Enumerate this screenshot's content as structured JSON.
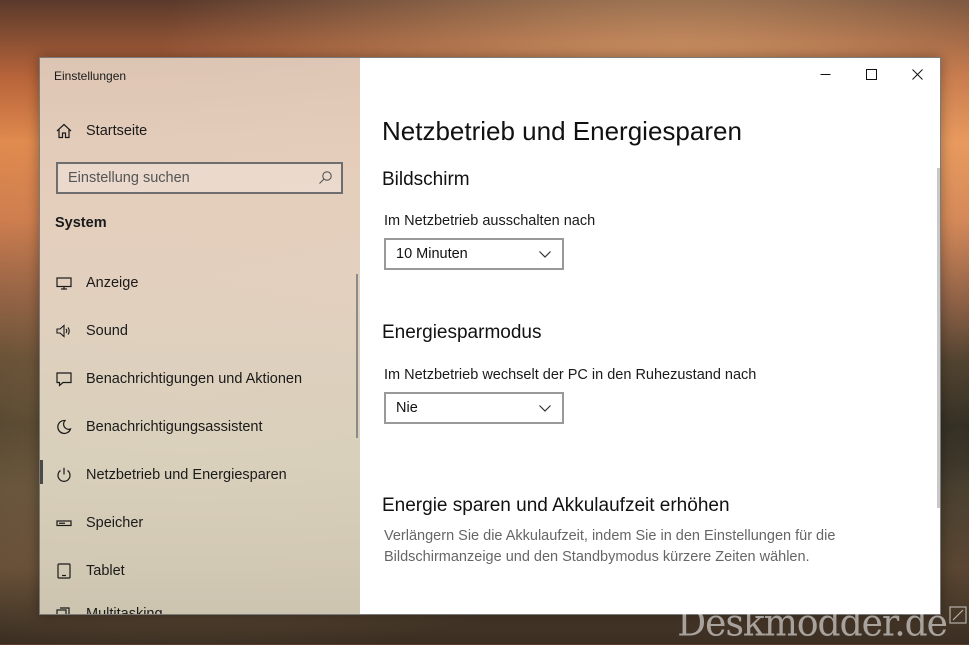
{
  "window": {
    "title": "Einstellungen"
  },
  "sidebar": {
    "home_label": "Startseite",
    "search_placeholder": "Einstellung suchen",
    "section": "System",
    "items": [
      {
        "label": "Anzeige",
        "icon": "monitor-icon"
      },
      {
        "label": "Sound",
        "icon": "speaker-icon"
      },
      {
        "label": "Benachrichtigungen und Aktionen",
        "icon": "notification-icon"
      },
      {
        "label": "Benachrichtigungsassistent",
        "icon": "moon-icon"
      },
      {
        "label": "Netzbetrieb und Energiesparen",
        "icon": "power-icon",
        "active": true
      },
      {
        "label": "Speicher",
        "icon": "storage-icon"
      },
      {
        "label": "Tablet",
        "icon": "tablet-icon"
      },
      {
        "label": "Multitasking",
        "icon": "multitasking-icon"
      }
    ]
  },
  "main": {
    "title": "Netzbetrieb und Energiesparen",
    "screen": {
      "heading": "Bildschirm",
      "label": "Im Netzbetrieb ausschalten nach",
      "value": "10 Minuten"
    },
    "sleep": {
      "heading": "Energiesparmodus",
      "label": "Im Netzbetrieb wechselt der PC in den Ruhezustand nach",
      "value": "Nie"
    },
    "battery": {
      "heading": "Energie sparen und Akkulaufzeit erhöhen",
      "description": "Verlängern Sie die Akkulaufzeit, indem Sie in den Einstellungen für die Bildschirmanzeige und den Standbymodus kürzere Zeiten wählen."
    }
  },
  "watermark": "Deskmodder.de",
  "colors": {
    "sidebar_bg": "#e6d6c6",
    "active_indicator": "#4a4a4a",
    "content_bg": "#ffffff"
  }
}
